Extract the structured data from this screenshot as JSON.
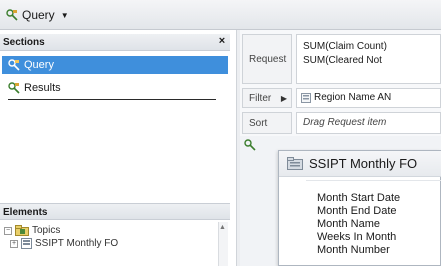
{
  "toolbar": {
    "query_menu_label": "Query"
  },
  "sections": {
    "title": "Sections",
    "close_label": "×",
    "items": [
      {
        "label": "Query",
        "selected": true
      },
      {
        "label": "Results",
        "selected": false
      }
    ]
  },
  "elements": {
    "title": "Elements",
    "tree": [
      {
        "label": "Topics"
      },
      {
        "label": "SSIPT Monthly FO"
      }
    ]
  },
  "query_panel": {
    "request_label": "Request",
    "request_items": [
      "SUM(Claim Count)",
      "SUM(Cleared Not"
    ],
    "filter_label": "Filter",
    "filter_item": "Region Name  AN",
    "sort_label": "Sort",
    "sort_placeholder": "Drag Request item"
  },
  "topic_window": {
    "title": "SSIPT Monthly FO",
    "fields": [
      "Month Start Date",
      "Month End Date",
      "Month Name",
      "Weeks In Month",
      "Month Number"
    ]
  },
  "colors": {
    "selection": "#3f8fdc",
    "header_bg": "#e3e6ea"
  }
}
